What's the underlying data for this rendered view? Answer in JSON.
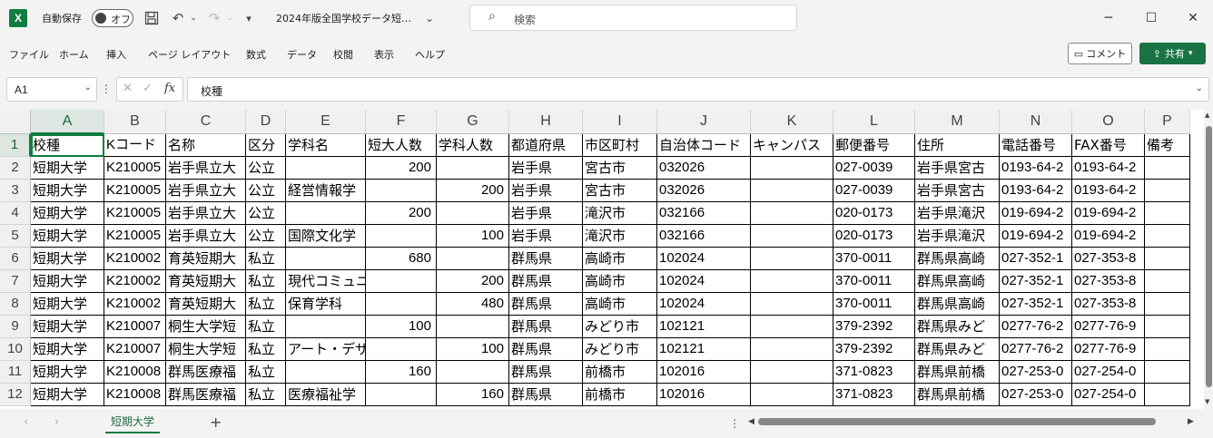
{
  "app": {
    "autosave_label": "自動保存",
    "autosave_state": "オフ",
    "file_title": "2024年版全国学校データ短…",
    "search_placeholder": "検索"
  },
  "ribbon": {
    "tabs": [
      "ファイル",
      "ホーム",
      "挿入",
      "ページ レイアウト",
      "数式",
      "データ",
      "校閲",
      "表示",
      "ヘルプ"
    ],
    "comment_label": "コメント",
    "share_label": "共有"
  },
  "formula_bar": {
    "name_box": "A1",
    "fx": "fx",
    "value": "校種"
  },
  "columns": [
    "A",
    "B",
    "C",
    "D",
    "E",
    "F",
    "G",
    "H",
    "I",
    "J",
    "K",
    "L",
    "M",
    "N",
    "O",
    "P"
  ],
  "row_numbers": [
    "1",
    "2",
    "3",
    "4",
    "5",
    "6",
    "7",
    "8",
    "9",
    "10",
    "11",
    "12"
  ],
  "rows": [
    [
      "校種",
      "Kコード",
      "名称",
      "区分",
      "学科名",
      "短大人数",
      "学科人数",
      "都道府県",
      "市区町村",
      "自治体コード",
      "キャンパス",
      "郵便番号",
      "住所",
      "電話番号",
      "FAX番号",
      "備考"
    ],
    [
      "短期大学",
      "K210005",
      "岩手県立大",
      "公立",
      "",
      "200",
      "",
      "岩手県",
      "宮古市",
      "032026",
      "",
      "027-0039",
      "岩手県宮古",
      "0193-64-2",
      "0193-64-2",
      ""
    ],
    [
      "短期大学",
      "K210005",
      "岩手県立大",
      "公立",
      "経営情報学",
      "",
      "200",
      "岩手県",
      "宮古市",
      "032026",
      "",
      "027-0039",
      "岩手県宮古",
      "0193-64-2",
      "0193-64-2",
      ""
    ],
    [
      "短期大学",
      "K210005",
      "岩手県立大",
      "公立",
      "",
      "200",
      "",
      "岩手県",
      "滝沢市",
      "032166",
      "",
      "020-0173",
      "岩手県滝沢",
      "019-694-2",
      "019-694-2",
      ""
    ],
    [
      "短期大学",
      "K210005",
      "岩手県立大",
      "公立",
      "国際文化学",
      "",
      "100",
      "岩手県",
      "滝沢市",
      "032166",
      "",
      "020-0173",
      "岩手県滝沢",
      "019-694-2",
      "019-694-2",
      ""
    ],
    [
      "短期大学",
      "K210002",
      "育英短期大",
      "私立",
      "",
      "680",
      "",
      "群馬県",
      "高崎市",
      "102024",
      "",
      "370-0011",
      "群馬県高崎",
      "027-352-1",
      "027-353-8",
      ""
    ],
    [
      "短期大学",
      "K210002",
      "育英短期大",
      "私立",
      "現代コミュニ",
      "",
      "200",
      "群馬県",
      "高崎市",
      "102024",
      "",
      "370-0011",
      "群馬県高崎",
      "027-352-1",
      "027-353-8",
      ""
    ],
    [
      "短期大学",
      "K210002",
      "育英短期大",
      "私立",
      "保育学科",
      "",
      "480",
      "群馬県",
      "高崎市",
      "102024",
      "",
      "370-0011",
      "群馬県高崎",
      "027-352-1",
      "027-353-8",
      ""
    ],
    [
      "短期大学",
      "K210007",
      "桐生大学短",
      "私立",
      "",
      "100",
      "",
      "群馬県",
      "みどり市",
      "102121",
      "",
      "379-2392",
      "群馬県みど",
      "0277-76-2",
      "0277-76-9",
      ""
    ],
    [
      "短期大学",
      "K210007",
      "桐生大学短",
      "私立",
      "アート・デザ",
      "",
      "100",
      "群馬県",
      "みどり市",
      "102121",
      "",
      "379-2392",
      "群馬県みど",
      "0277-76-2",
      "0277-76-9",
      ""
    ],
    [
      "短期大学",
      "K210008",
      "群馬医療福",
      "私立",
      "",
      "160",
      "",
      "群馬県",
      "前橋市",
      "102016",
      "",
      "371-0823",
      "群馬県前橋",
      "027-253-0",
      "027-254-0",
      ""
    ],
    [
      "短期大学",
      "K210008",
      "群馬医療福",
      "私立",
      "医療福祉学",
      "",
      "160",
      "群馬県",
      "前橋市",
      "102016",
      "",
      "371-0823",
      "群馬県前橋",
      "027-253-0",
      "027-254-0",
      ""
    ]
  ],
  "sheet_tabs": [
    "短期大学"
  ]
}
